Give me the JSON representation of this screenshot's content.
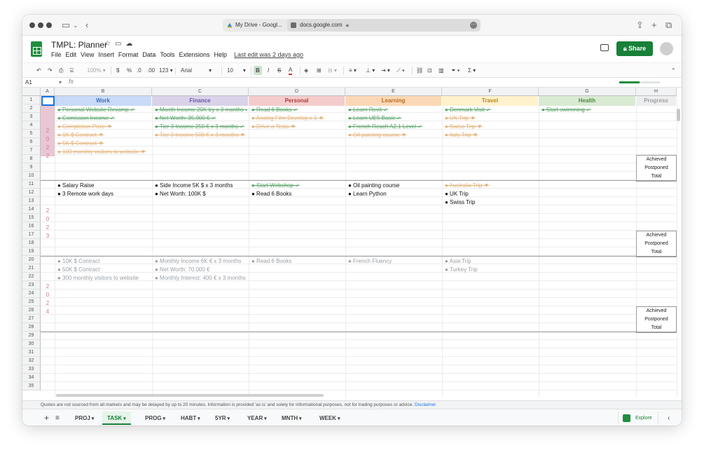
{
  "browser": {
    "tab_title": "My Drive - Googl...",
    "address": "docs.google.com"
  },
  "doc": {
    "title": "TMPL: Planner",
    "menu": [
      "File",
      "Edit",
      "View",
      "Insert",
      "Format",
      "Data",
      "Tools",
      "Extensions",
      "Help"
    ],
    "last_edit": "Last edit was 2 days ago",
    "share_label": "Share"
  },
  "toolbar": {
    "zoom": "100%",
    "currency": "$",
    "percent": "%",
    "dec_less": ".0",
    "dec_more": ".00",
    "format_123": "123",
    "font": "Arial",
    "font_size": "10",
    "bold": "B",
    "italic": "I",
    "strike": "S",
    "text_color": "A"
  },
  "formula": {
    "cell_ref": "A1",
    "fx": "fx",
    "progress_fraction": 0.5
  },
  "columns": [
    "A",
    "B",
    "C",
    "D",
    "E",
    "F",
    "G",
    "H"
  ],
  "categories": [
    {
      "label": "Work",
      "bg": "#c9daf8",
      "fg": "#3d6fb6"
    },
    {
      "label": "Finance",
      "bg": "#d9d2e9",
      "fg": "#6a56a8"
    },
    {
      "label": "Personal",
      "bg": "#f4cccc",
      "fg": "#b03a3a"
    },
    {
      "label": "Learning",
      "bg": "#fbd8b5",
      "fg": "#b96a22"
    },
    {
      "label": "Travel",
      "bg": "#fff2cc",
      "fg": "#b8861b"
    },
    {
      "label": "Health",
      "bg": "#d9ead3",
      "fg": "#4e8a3e"
    },
    {
      "label": "Progress",
      "bg": "#eeeeee",
      "fg": "#9aa0a6"
    }
  ],
  "rows": [
    "1",
    "2",
    "3",
    "4",
    "5",
    "6",
    "7",
    "8",
    "9",
    "10",
    "11",
    "12",
    "13",
    "14",
    "15",
    "16",
    "17",
    "18",
    "19",
    "20",
    "21",
    "22",
    "23",
    "24",
    "25",
    "26",
    "27",
    "28",
    "29",
    "30",
    "31",
    "32",
    "33",
    "34",
    "35"
  ],
  "years": [
    {
      "digits": [
        "2",
        "0",
        "2",
        "2"
      ]
    },
    {
      "digits": [
        "2",
        "0",
        "2",
        "3"
      ]
    },
    {
      "digits": [
        "2",
        "0",
        "2",
        "4"
      ]
    }
  ],
  "goals_2022": {
    "work": [
      {
        "t": "● Personal Website Revamp ✓",
        "s": "done"
      },
      {
        "t": "● Comission Income ✓",
        "s": "done"
      },
      {
        "t": "● Completion Prize ▼",
        "s": "post"
      },
      {
        "t": "● 1K $ Contract ▼",
        "s": "post"
      },
      {
        "t": "● 5K $ Contract ▼",
        "s": "post"
      },
      {
        "t": "● 100 monthly visitors to website ▼",
        "s": "post"
      }
    ],
    "finance": [
      {
        "t": "● Month Income 20K try x 3 months ✓",
        "s": "done"
      },
      {
        "t": "● Net Worth: 35.000 € ✓",
        "s": "done"
      },
      {
        "t": "● Tier 3 Income 250 € x 3 months ✓",
        "s": "done"
      },
      {
        "t": "● Tier 3 Income 500 € x 3 months ▼",
        "s": "post"
      }
    ],
    "personal": [
      {
        "t": "● Read 6 Books ✓",
        "s": "done"
      },
      {
        "t": "● Analog Film Develop x 1 ▼",
        "s": "post"
      },
      {
        "t": "● Drive a Tesla ▼",
        "s": "post"
      }
    ],
    "learning": [
      {
        "t": "● Learn Revit ✓",
        "s": "done"
      },
      {
        "t": "● Learn UE5 Basic ✓",
        "s": "done"
      },
      {
        "t": "● French Reach A2.1 Level ✓",
        "s": "done"
      },
      {
        "t": "● Oil painting course ▼",
        "s": "post"
      }
    ],
    "travel": [
      {
        "t": "● Denmark Visit ✓",
        "s": "done"
      },
      {
        "t": "● UK Trip ▼",
        "s": "post"
      },
      {
        "t": "● Swiss Trip ▼",
        "s": "post"
      },
      {
        "t": "● Italy Trip ▼",
        "s": "post"
      }
    ],
    "health": [
      {
        "t": "● Start swimming ✓",
        "s": "done"
      }
    ]
  },
  "goals_2023": {
    "work": [
      {
        "t": "● Salary Raise",
        "s": "act"
      },
      {
        "t": "● 3 Remote work days",
        "s": "act"
      }
    ],
    "finance": [
      {
        "t": "● Side Income 5K $ x 3 months",
        "s": "act"
      },
      {
        "t": "● Net Worth: 100K $",
        "s": "act"
      }
    ],
    "personal": [
      {
        "t": "● Start Webshop ✓",
        "s": "done"
      },
      {
        "t": "● Read 6 Books",
        "s": "act"
      }
    ],
    "learning": [
      {
        "t": "● Oil painting course",
        "s": "act"
      },
      {
        "t": "● Learn Python",
        "s": "act"
      }
    ],
    "travel": [
      {
        "t": "● Australia Trip ▼",
        "s": "post"
      },
      {
        "t": "● UK Trip",
        "s": "act"
      },
      {
        "t": "● Swiss Trip",
        "s": "act"
      }
    ],
    "health": []
  },
  "goals_2024": {
    "work": [
      {
        "t": "● 10K $ Contract",
        "s": "fut"
      },
      {
        "t": "● 50K $ Contract",
        "s": "fut"
      },
      {
        "t": "● 300 monthly visitors to website",
        "s": "fut"
      }
    ],
    "finance": [
      {
        "t": "● Monthly Income 6K € x 3 months",
        "s": "fut"
      },
      {
        "t": "● Net Worth: 70.000 €",
        "s": "fut"
      },
      {
        "t": "● Monthly Interest: 400 € x 3 months",
        "s": "fut"
      }
    ],
    "personal": [
      {
        "t": "● Read 6 Books",
        "s": "fut"
      }
    ],
    "learning": [
      {
        "t": "● French Fluency",
        "s": "fut"
      }
    ],
    "travel": [
      {
        "t": "● Asia Trip",
        "s": "fut"
      },
      {
        "t": "● Turkey Trip",
        "s": "fut"
      }
    ],
    "health": []
  },
  "summary_labels": [
    "Achieved",
    "Postponed",
    "Total"
  ],
  "disclaimer": {
    "text": "Quotes are not sourced from all markets and may be delayed by up to 20 minutes. Information is provided 'as is' and solely for informational purposes, not for trading purposes or advice.",
    "link": "Disclaimer"
  },
  "sheet_tabs": [
    {
      "label": "PROJ",
      "active": false
    },
    {
      "label": "TASK",
      "active": true
    },
    {
      "label": "PROG",
      "active": false
    },
    {
      "label": "HABT",
      "active": false
    },
    {
      "label": "5YR",
      "active": false
    },
    {
      "label": "YEAR",
      "active": false
    },
    {
      "label": "MNTH",
      "active": false
    },
    {
      "label": "WEEK",
      "active": false
    }
  ],
  "explore_label": "Explore"
}
